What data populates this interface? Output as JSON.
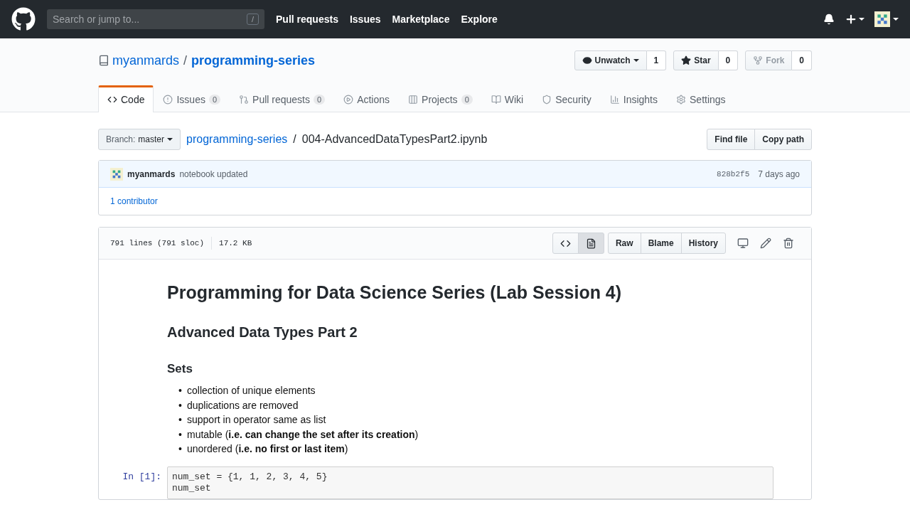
{
  "header": {
    "search_placeholder": "Search or jump to...",
    "search_key": "/",
    "nav": [
      "Pull requests",
      "Issues",
      "Marketplace",
      "Explore"
    ]
  },
  "repo": {
    "owner": "myanmards",
    "separator": "/",
    "name": "programming-series",
    "actions": [
      {
        "label": "Unwatch",
        "count": "1",
        "disabled": false,
        "dropdown": true
      },
      {
        "label": "Star",
        "count": "0",
        "disabled": false,
        "dropdown": false
      },
      {
        "label": "Fork",
        "count": "0",
        "disabled": true,
        "dropdown": false
      }
    ]
  },
  "tabs": [
    {
      "label": "Code",
      "selected": true
    },
    {
      "label": "Issues",
      "count": "0",
      "selected": false
    },
    {
      "label": "Pull requests",
      "count": "0",
      "selected": false
    },
    {
      "label": "Actions",
      "selected": false
    },
    {
      "label": "Projects",
      "count": "0",
      "selected": false
    },
    {
      "label": "Wiki",
      "selected": false
    },
    {
      "label": "Security",
      "selected": false
    },
    {
      "label": "Insights",
      "selected": false
    },
    {
      "label": "Settings",
      "selected": false
    }
  ],
  "branch": {
    "label": "Branch:",
    "value": "master"
  },
  "breadcrumb": {
    "repo": "programming-series",
    "separator": "/",
    "file": "004-AdvancedDataTypesPart2.ipynb"
  },
  "file_actions": [
    "Find file",
    "Copy path"
  ],
  "commit": {
    "author": "myanmards",
    "message": "notebook updated",
    "sha": "828b2f5",
    "time": "7 days ago",
    "contributors": "1 contributor"
  },
  "file": {
    "lines": "791 lines (791 sloc)",
    "size": "17.2 KB",
    "view_modes": [
      {
        "selected": false
      },
      {
        "selected": true
      }
    ],
    "buttons": [
      "Raw",
      "Blame",
      "History"
    ]
  },
  "notebook": {
    "title": "Programming for Data Science Series (Lab Session 4)",
    "subtitle": "Advanced Data Types Part 2",
    "section": "Sets",
    "bullets": [
      {
        "marker": "•",
        "text": "collection of unique elements"
      },
      {
        "marker": "•",
        "text": "duplications are removed"
      },
      {
        "marker": "•",
        "text": "support in operator same as list"
      },
      {
        "marker": "•",
        "text": "mutable (**i.e. can change the set after its creation**)"
      },
      {
        "marker": "•",
        "text": "unordered (**i.e. no first or last item**)"
      }
    ],
    "cells": [
      {
        "prompt": "In [1]:",
        "code": [
          "num_set = {1, 1, 2, 3, 4, 5}",
          "num_set"
        ]
      }
    ]
  }
}
